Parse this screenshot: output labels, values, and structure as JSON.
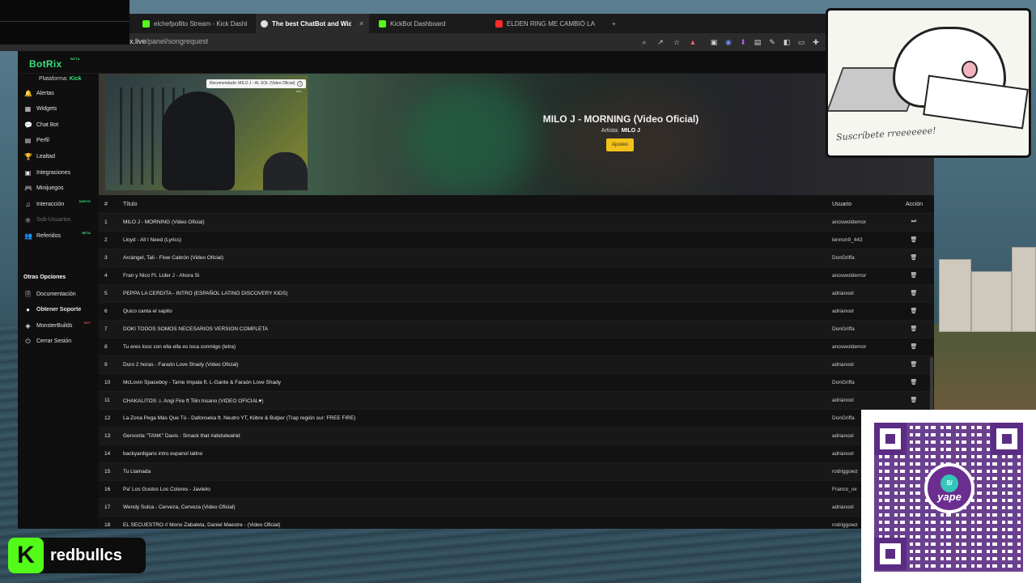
{
  "browser": {
    "tabs": [
      {
        "label": "elchefpollito Stream - Kick Dashboard",
        "favicon_color": "#53fc18",
        "active": false
      },
      {
        "label": "The best ChatBot and Widgets",
        "favicon_color": "#e0e0e0",
        "active": true
      },
      {
        "label": "KickBot Dashboard",
        "favicon_color": "#53fc18",
        "active": false
      },
      {
        "label": "ELDEN RING ME CAMBIÓ LA VIDA",
        "favicon_color": "#ff2a2a",
        "active": false
      }
    ],
    "new_tab_icon": "+",
    "url_prefix": "",
    "url_host": "x.live",
    "url_path": "/panel/songrequest"
  },
  "app": {
    "logo": "BotRix",
    "logo_badge": "BETA",
    "accent_color": "#38e07b",
    "platform_label": "Plataforma:",
    "platform_value": "Kick",
    "nav": [
      {
        "label": "Alertas",
        "icon": "bell-icon",
        "glyph": "🔔"
      },
      {
        "label": "Widgets",
        "icon": "widgets-icon",
        "glyph": "▦"
      },
      {
        "label": "Chat Bot",
        "icon": "chat-icon",
        "glyph": "💬"
      },
      {
        "label": "Perfil",
        "icon": "profile-icon",
        "glyph": "▤"
      },
      {
        "label": "Lealtad",
        "icon": "trophy-icon",
        "glyph": "🏆"
      },
      {
        "label": "Integraciones",
        "icon": "integrations-icon",
        "glyph": "▣"
      },
      {
        "label": "Minijuegos",
        "icon": "games-icon",
        "glyph": "🎮"
      },
      {
        "label": "Interacción",
        "icon": "music-icon",
        "glyph": "♫",
        "badge": "NUEVO"
      },
      {
        "label": "Sub-Usuarios",
        "icon": "users-icon",
        "glyph": "◉",
        "dim": true
      },
      {
        "label": "Referidos",
        "icon": "referrals-icon",
        "glyph": "👥",
        "badge": "BETA"
      }
    ],
    "other_options_heading": "Otras Opciones",
    "other_nav": [
      {
        "label": "Documentación",
        "icon": "docs-icon",
        "glyph": "🗎"
      },
      {
        "label": "Obtener Soporte",
        "icon": "support-icon",
        "glyph": "●",
        "bold": true
      },
      {
        "label": "MonsterBuilds",
        "icon": "monster-icon",
        "glyph": "◈",
        "badge": "HOT"
      },
      {
        "label": "Cerrar Sesión",
        "icon": "logout-icon",
        "glyph": "⏻"
      }
    ]
  },
  "now_playing": {
    "recommended_tip": "Recomendado: MILO J - AL SOL (Video Oficial)",
    "info_label": "Info",
    "title": "MILO J - MORNING (Video Oficial)",
    "artist_label": "Artista:",
    "artist": "MILO J",
    "settings_label": "Ajustes"
  },
  "queue": {
    "columns": {
      "num": "#",
      "title": "Título",
      "user": "Usuario",
      "action": "Acción"
    },
    "rows": [
      {
        "num": "1",
        "title": "MILO J - MORNING (Video Oficial)",
        "user": "anoswoldemor",
        "action": "skip"
      },
      {
        "num": "2",
        "title": "Lloyd - All I Need (Lyrics)",
        "user": "lennon9_443",
        "action": "delete"
      },
      {
        "num": "3",
        "title": "Arcángel, Tali - Flow Cabrón (Video Oficial)",
        "user": "DonGriffa",
        "action": "delete"
      },
      {
        "num": "4",
        "title": "Fran y Nico Ft. Lider J - Ahora Si",
        "user": "anoswoldemor",
        "action": "delete"
      },
      {
        "num": "5",
        "title": "PEPPA LA CERDITA - INTRO (ESPAÑOL LATINO DISCOVERY KIDS)",
        "user": "adrianool",
        "action": "delete"
      },
      {
        "num": "6",
        "title": "Quico canta el sapito",
        "user": "adrianool",
        "action": "delete"
      },
      {
        "num": "7",
        "title": "DOKI TODOS SOMOS NECESARIOS VERSION COMPLETA",
        "user": "DonGriffa",
        "action": "delete"
      },
      {
        "num": "8",
        "title": "Tu eres loco con ella ella es loca conmigo (letra)",
        "user": "anoswoldemor",
        "action": "delete"
      },
      {
        "num": "9",
        "title": "Duro 2 horas - Faraón Love Shady (Video Oficial)",
        "user": "adrianool",
        "action": "delete"
      },
      {
        "num": "10",
        "title": "McLovin Spaceboy - Tame Impala ft. L-Gante & Faraón Love Shady",
        "user": "DonGriffa",
        "action": "delete"
      },
      {
        "num": "11",
        "title": "CHAKALITOS ♨ Angi Fire ft Tilin Insano (VIDEO OFICIAL♥)",
        "user": "adrianool",
        "action": "delete"
      },
      {
        "num": "12",
        "title": "La Zona Pega Más Que Tú - Dafonseka ft. Neutro YT, Kiibre & Bulper (Trap región sur: FREE FIRE)",
        "user": "DonGriffa",
        "action": ""
      },
      {
        "num": "13",
        "title": "Gervonta \"TANK\" Davis - Smack that #abdulwahid",
        "user": "adrianool",
        "action": ""
      },
      {
        "num": "14",
        "title": "backyardigans intro espanol latino",
        "user": "adrianool",
        "action": ""
      },
      {
        "num": "15",
        "title": "Tu Llamada",
        "user": "rodriggowz",
        "action": ""
      },
      {
        "num": "16",
        "title": "Pa' Los Gustos Los Colores - Javiielo",
        "user": "Franco_ox",
        "action": ""
      },
      {
        "num": "17",
        "title": "Wendy Sulca - Cerveza, Cerveza (Video Oficial)",
        "user": "adrianool",
        "action": ""
      },
      {
        "num": "18",
        "title": "EL SECUESTRO // Mono Zabaleta, Daniel Maestre - (Video Oficial)",
        "user": "rodriggowz",
        "action": ""
      }
    ]
  },
  "overlays": {
    "catcam_caption": "Suscríbete  rreeeeeee!",
    "qr_currency": "S/",
    "qr_brand": "yape",
    "qr_color": "#5b2c83",
    "kick_logo": "K",
    "kick_color": "#53fc18",
    "channel_name": "redbullcs"
  }
}
